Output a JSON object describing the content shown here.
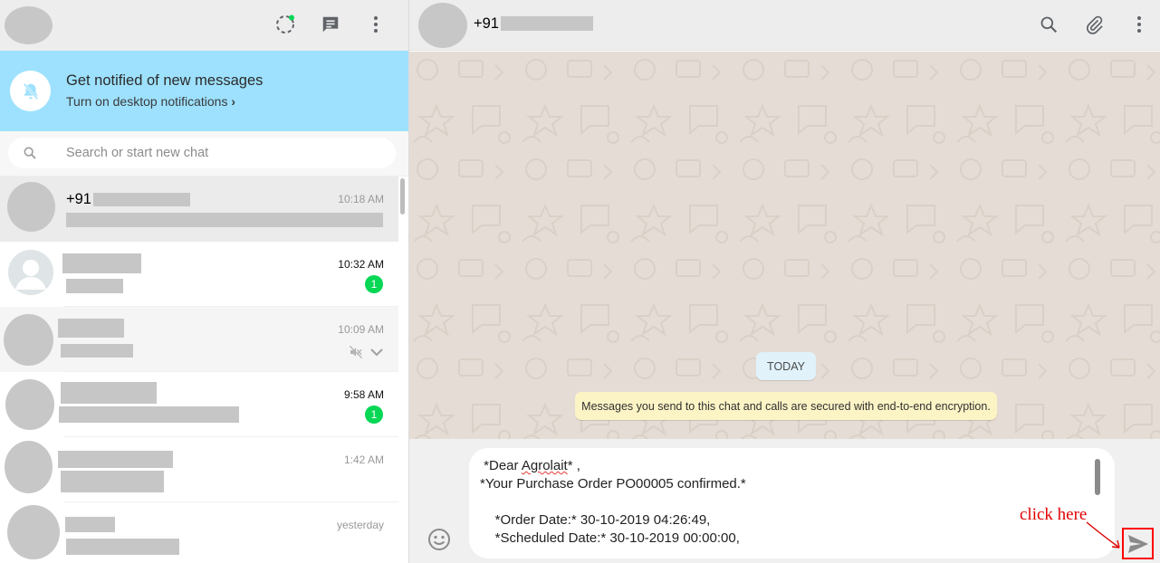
{
  "left_header": {
    "icons": [
      "status-icon",
      "new-chat-icon",
      "menu-icon"
    ],
    "status_accent": "#06d755"
  },
  "notification": {
    "title": "Get notified of new messages",
    "link": "Turn on desktop notifications",
    "link_chevron": "›",
    "bg_color": "#9de1fe"
  },
  "search": {
    "placeholder": "Search or start new chat"
  },
  "chats": [
    {
      "name": "+91",
      "time": "10:18 AM",
      "unread": null,
      "selected": true
    },
    {
      "name": "",
      "time": "10:32 AM",
      "unread": "1",
      "selected": false
    },
    {
      "name": "",
      "time": "10:09 AM",
      "unread": null,
      "muted": true,
      "selected": false
    },
    {
      "name": "",
      "time": "9:58 AM",
      "unread": "1",
      "selected": false
    },
    {
      "name": "",
      "time": "1:42 AM",
      "unread": null,
      "selected": false
    },
    {
      "name": "",
      "time": "yesterday",
      "unread": null,
      "selected": false
    }
  ],
  "conversation": {
    "contact_name": "+91",
    "header_icons": [
      "search-icon",
      "attach-icon",
      "menu-icon"
    ],
    "date_divider": "TODAY",
    "system_message": "Messages you send to this chat and calls are secured with end-to-end encryption.",
    "compose_lines": [
      " *Dear Agrolait* ,",
      "*Your Purchase Order PO00005 confirmed.*",
      "",
      "    *Order Date:* 30-10-2019 04:26:49,",
      "    *Scheduled Date:* 30-10-2019 00:00:00,"
    ],
    "compose_misspelled_word": "Agrolait",
    "annotation": "click  here",
    "annotation_color": "#ff0000"
  },
  "colors": {
    "badge_green": "#06d755",
    "header_bg": "#ededed",
    "chat_bg": "#e5ddd5"
  }
}
